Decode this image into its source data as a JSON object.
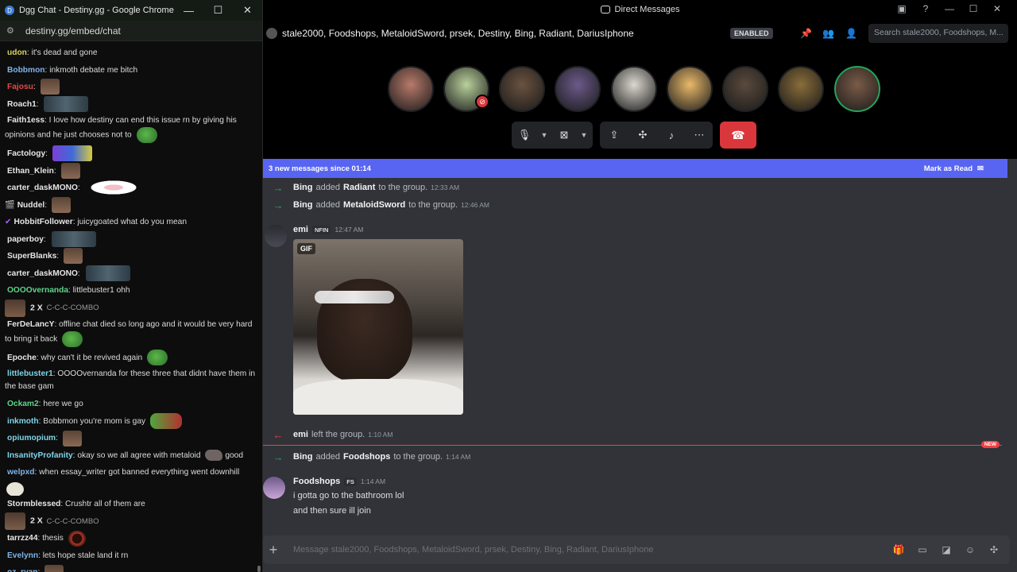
{
  "chrome": {
    "window_title": "Dgg Chat - Destiny.gg - Google Chrome",
    "url": "destiny.gg/embed/chat",
    "controls": [
      "—",
      "☐",
      "✕"
    ],
    "messages": [
      {
        "user": "udon",
        "color": "#d8d35a",
        "text": "it's dead and gone"
      },
      {
        "user": "Bobbmon",
        "color": "#7fb3e8",
        "text": "inkmoth debate me bitch"
      },
      {
        "user": "Fajosu",
        "color": "#e24848",
        "text": ""
      },
      {
        "user": "Roach1",
        "color": "#e6e6e6",
        "text": ""
      },
      {
        "user": "Faith1ess",
        "color": "#e6e6e6",
        "text": "I love how destiny can end this issue rn by giving his opinions and he just chooses not to"
      },
      {
        "user": "Factology",
        "color": "#e6e6e6",
        "text": ""
      },
      {
        "user": "Ethan_Klein",
        "color": "#e6e6e6",
        "text": ""
      },
      {
        "user": "carter_daskMONO",
        "color": "#e6e6e6",
        "text": ""
      },
      {
        "user": "Nuddel",
        "color": "#e6e6e6",
        "text": ""
      },
      {
        "user": "HobbitFollower",
        "color": "#e6e6e6",
        "text": "juicygoated what do you mean"
      },
      {
        "user": "paperboy",
        "color": "#e6e6e6",
        "text": ""
      },
      {
        "user": "SuperBlanks",
        "color": "#e6e6e6",
        "text": ""
      },
      {
        "user": "carter_daskMONO",
        "color": "#e6e6e6",
        "text": ""
      },
      {
        "user": "OOOOvernanda",
        "color": "#5fd48a",
        "text": "littlebuster1 ohh"
      },
      {
        "user": "FerDeLancY",
        "color": "#e6e6e6",
        "text": "offline chat died so long ago and it would be very hard to bring it back"
      },
      {
        "user": "Epoche",
        "color": "#e6e6e6",
        "text": "why can't it be revived again"
      },
      {
        "user": "littlebuster1",
        "color": "#7fd4e8",
        "text": "OOOOvernanda for these three that didnt have them in the base gam"
      },
      {
        "user": "Ockam2",
        "color": "#5fd48a",
        "text": "here we go"
      },
      {
        "user": "inkmoth",
        "color": "#7fd4e8",
        "text": "Bobbmon you're mom is gay"
      },
      {
        "user": "opiumopium",
        "color": "#7fd4e8",
        "text": ""
      },
      {
        "user": "InsanityProfanity",
        "color": "#7fd4e8",
        "text": "okay so we all agree with metaloid"
      },
      {
        "user": "welpxd",
        "color": "#7fb3e8",
        "text": "when essay_writer got banned everything went downhill"
      },
      {
        "user": "Stormblessed",
        "color": "#e6e6e6",
        "text": "Crushtr all of them are"
      },
      {
        "user": "tarrzz44",
        "color": "#e6e6e6",
        "text": "thesis"
      },
      {
        "user": "Evelynn",
        "color": "#7fb3e8",
        "text": "lets hope stale land it rn"
      },
      {
        "user": "oz_ryan",
        "color": "#7fb3e8",
        "text": ""
      }
    ],
    "combo_count": "2 X",
    "combo_text": "C-C-C-COMBO",
    "good_text": "good"
  },
  "discord": {
    "window_title": "Direct Messages",
    "dm_name": "stale2000, Foodshops, MetaloidSword, prsek, Destiny, Bing, Radiant, DariusIphone",
    "enabled_badge": "ENABLED",
    "search_placeholder": "Search stale2000, Foodshops, M...",
    "call_participants": [
      {
        "color": "#b87a6a",
        "speaking": false,
        "muted": false
      },
      {
        "color": "#b9d19b",
        "speaking": false,
        "muted": true
      },
      {
        "color": "#6a5240",
        "speaking": false,
        "muted": false
      },
      {
        "color": "#6b5a8a",
        "speaking": false,
        "muted": false
      },
      {
        "color": "#dcd8cf",
        "speaking": false,
        "muted": false
      },
      {
        "color": "#e9b96a",
        "speaking": false,
        "muted": false
      },
      {
        "color": "#5a4a3c",
        "speaking": false,
        "muted": false
      },
      {
        "color": "#8a6d3a",
        "speaking": false,
        "muted": false
      },
      {
        "color": "#7a5b47",
        "speaking": true,
        "muted": false
      }
    ],
    "new_messages_text": "3 new messages since 01:14",
    "mark_as_read": "Mark as Read",
    "system_messages": [
      {
        "actor": "Bing",
        "action": "added",
        "target": "Radiant",
        "suffix": "to the group.",
        "time": "12:33 AM"
      },
      {
        "actor": "Bing",
        "action": "added",
        "target": "MetaloidSword",
        "suffix": "to the group.",
        "time": "12:46 AM"
      },
      {
        "actor": "emi",
        "action": "left the group.",
        "target": "",
        "suffix": "",
        "time": "1:10 AM"
      },
      {
        "actor": "Bing",
        "action": "added",
        "target": "Foodshops",
        "suffix": "to the group.",
        "time": "1:14 AM"
      }
    ],
    "emi_message": {
      "user": "emi",
      "tag": "NFIN",
      "time": "12:47 AM",
      "gif_label": "GIF"
    },
    "foodshops_message": {
      "user": "Foodshops",
      "tag": "FS",
      "time": "1:14 AM",
      "lines": [
        "i gotta go to the bathroom lol",
        "and then sure ill join"
      ]
    },
    "new_label": "NEW",
    "composer_placeholder": "Message stale2000, Foodshops, MetaloidSword, prsek, Destiny, Bing, Radiant, DariusIphone",
    "accent": "#5865f2",
    "danger": "#da373c"
  }
}
